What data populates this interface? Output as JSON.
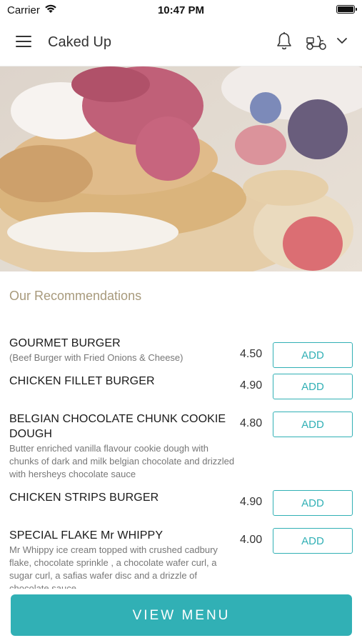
{
  "status_bar": {
    "carrier": "Carrier",
    "time": "10:47 PM"
  },
  "header": {
    "title": "Caked Up",
    "icons": [
      "menu-icon",
      "bell-icon",
      "scooter-icon",
      "chevron-down-icon"
    ]
  },
  "section": {
    "title": "Our Recommendations"
  },
  "items": [
    {
      "name": "GOURMET BURGER",
      "description": "(Beef Burger with Fried Onions & Cheese)",
      "price": "4.50",
      "button": "ADD"
    },
    {
      "name": "CHICKEN FILLET BURGER",
      "description": "",
      "price": "4.90",
      "button": "ADD"
    },
    {
      "name": "BELGIAN CHOCOLATE CHUNK COOKIE DOUGH",
      "description": "Butter enriched vanilla flavour cookie dough with chunks of dark and milk belgian chocolate and drizzled with hersheys chocolate sauce",
      "price": "4.80",
      "button": "ADD"
    },
    {
      "name": "CHICKEN STRIPS BURGER",
      "description": "",
      "price": "4.90",
      "button": "ADD"
    },
    {
      "name": "SPECIAL FLAKE Mr WHIPPY",
      "description": "Mr Whippy ice cream topped with crushed cadbury flake, chocolate sprinkle , a chocolate wafer curl, a sugar curl, a safias wafer disc and a drizzle of chocolate sauce",
      "price": "4.00",
      "button": "ADD"
    }
  ],
  "footer": {
    "view_menu_label": "VIEW MENU"
  },
  "colors": {
    "accent": "#31b0b5",
    "section_title": "#a89a7c"
  }
}
